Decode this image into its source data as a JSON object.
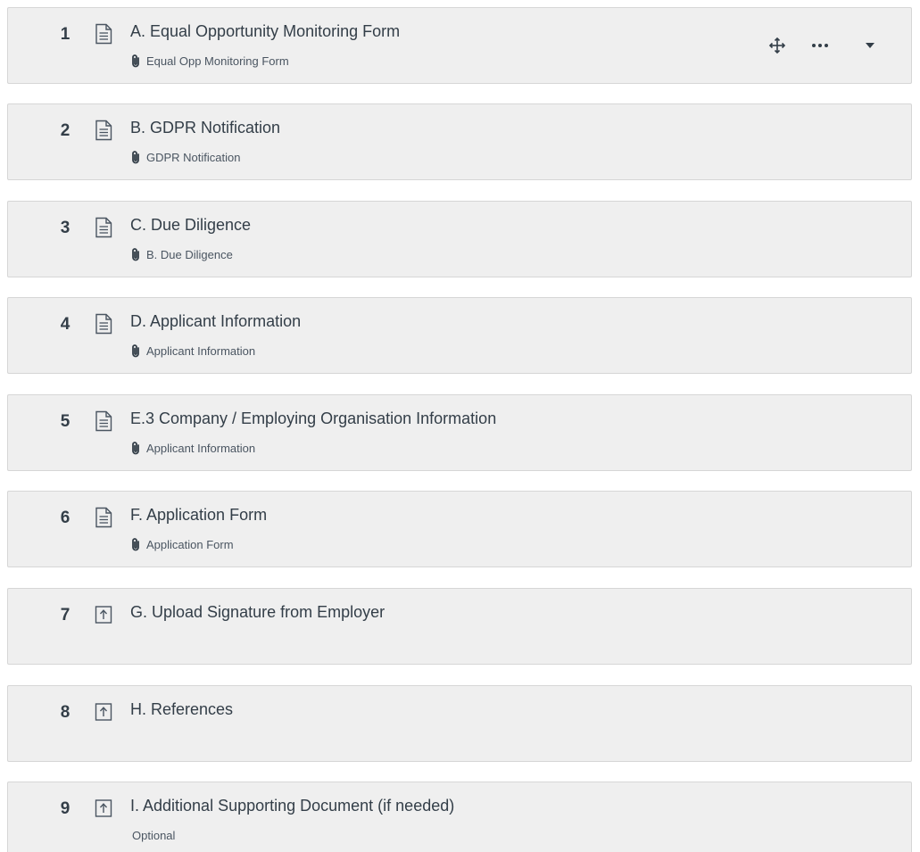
{
  "questions": [
    {
      "number": "1",
      "type_icon": "document-icon",
      "title": "A. Equal Opportunity Monitoring Form",
      "subtitle": "Equal Opp Monitoring Form",
      "subtitle_icon": "paperclip-icon"
    },
    {
      "number": "2",
      "type_icon": "document-icon",
      "title": "B. GDPR Notification",
      "subtitle": "GDPR Notification",
      "subtitle_icon": "paperclip-icon"
    },
    {
      "number": "3",
      "type_icon": "document-icon",
      "title": "C. Due Diligence",
      "subtitle": "B. Due Diligence",
      "subtitle_icon": "paperclip-icon"
    },
    {
      "number": "4",
      "type_icon": "document-icon",
      "title": "D. Applicant Information",
      "subtitle": "Applicant Information",
      "subtitle_icon": "paperclip-icon"
    },
    {
      "number": "5",
      "type_icon": "document-icon",
      "title": "E.3 Company / Employing Organisation Information",
      "subtitle": "Applicant Information",
      "subtitle_icon": "paperclip-icon"
    },
    {
      "number": "6",
      "type_icon": "document-icon",
      "title": "F. Application Form",
      "subtitle": "Application Form",
      "subtitle_icon": "paperclip-icon"
    },
    {
      "number": "7",
      "type_icon": "upload-icon",
      "title": "G. Upload Signature from Employer",
      "subtitle": ""
    },
    {
      "number": "8",
      "type_icon": "upload-icon",
      "title": "H. References",
      "subtitle": ""
    },
    {
      "number": "9",
      "type_icon": "upload-icon",
      "title": "I. Additional Supporting Document (if needed)",
      "subtitle": "Optional"
    }
  ],
  "row_actions": {
    "move_icon": "move-icon",
    "more_icon": "more-options-icon",
    "expand_icon": "caret-down-icon"
  },
  "colors": {
    "card_background": "#efefef",
    "card_border": "#d6d6d6",
    "text": "#333e48"
  }
}
